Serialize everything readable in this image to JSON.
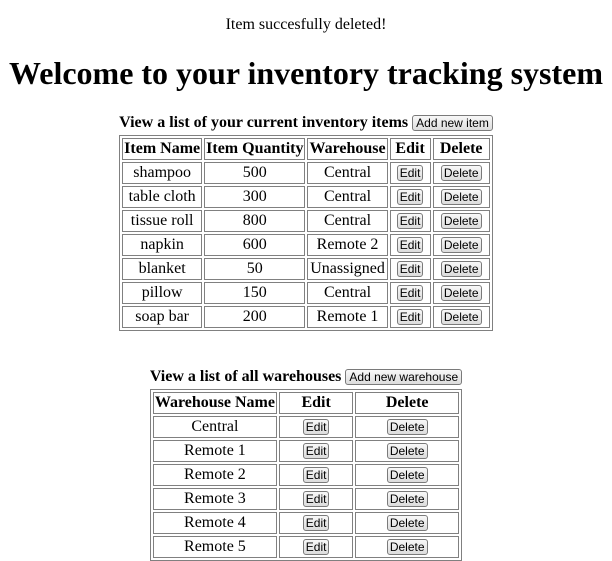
{
  "flash_message": "Item succesfully deleted!",
  "page_title": "Welcome to your inventory tracking system",
  "inventory": {
    "caption": "View a list of your current inventory items",
    "add_button": "Add new item",
    "headers": {
      "name": "Item Name",
      "quantity": "Item Quantity",
      "warehouse": "Warehouse",
      "edit": "Edit",
      "delete": "Delete"
    },
    "rows": [
      {
        "name": "shampoo",
        "quantity": "500",
        "warehouse": "Central",
        "edit": "Edit",
        "delete": "Delete"
      },
      {
        "name": "table cloth",
        "quantity": "300",
        "warehouse": "Central",
        "edit": "Edit",
        "delete": "Delete"
      },
      {
        "name": "tissue roll",
        "quantity": "800",
        "warehouse": "Central",
        "edit": "Edit",
        "delete": "Delete"
      },
      {
        "name": "napkin",
        "quantity": "600",
        "warehouse": "Remote 2",
        "edit": "Edit",
        "delete": "Delete"
      },
      {
        "name": "blanket",
        "quantity": "50",
        "warehouse": "Unassigned",
        "edit": "Edit",
        "delete": "Delete"
      },
      {
        "name": "pillow",
        "quantity": "150",
        "warehouse": "Central",
        "edit": "Edit",
        "delete": "Delete"
      },
      {
        "name": "soap bar",
        "quantity": "200",
        "warehouse": "Remote 1",
        "edit": "Edit",
        "delete": "Delete"
      }
    ]
  },
  "warehouses": {
    "caption": "View a list of all warehouses",
    "add_button": "Add new warehouse",
    "headers": {
      "name": "Warehouse Name",
      "edit": "Edit",
      "delete": "Delete"
    },
    "rows": [
      {
        "name": "Central",
        "edit": "Edit",
        "delete": "Delete"
      },
      {
        "name": "Remote 1",
        "edit": "Edit",
        "delete": "Delete"
      },
      {
        "name": "Remote 2",
        "edit": "Edit",
        "delete": "Delete"
      },
      {
        "name": "Remote 3",
        "edit": "Edit",
        "delete": "Delete"
      },
      {
        "name": "Remote 4",
        "edit": "Edit",
        "delete": "Delete"
      },
      {
        "name": "Remote 5",
        "edit": "Edit",
        "delete": "Delete"
      }
    ]
  }
}
